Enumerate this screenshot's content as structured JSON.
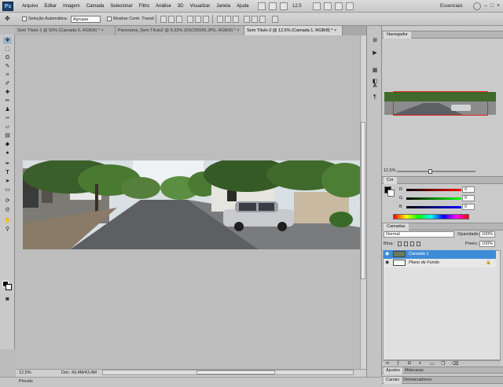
{
  "app": {
    "logo": "Ps"
  },
  "menu": [
    "Arquivo",
    "Editar",
    "Imagem",
    "Camada",
    "Selecionar",
    "Filtro",
    "Análise",
    "3D",
    "Visualizar",
    "Janela",
    "Ajuda"
  ],
  "menubar": {
    "zoom": "12,5",
    "workspace": "Essenciais",
    "minimize": "–",
    "restore": "□",
    "close": "×"
  },
  "options": {
    "auto_select_label": "Seleção Automática:",
    "auto_select_value": "Agrupar",
    "transform_label": "Mostrar Contr. Transf."
  },
  "tabs": [
    {
      "label": "Sem Título-1 @ 50% (Camada 6, RGB/8) *",
      "close": "×"
    },
    {
      "label": "Panorama_Sem Título2 @ 8,33% (DSC05556.JPG, RGB/8) *",
      "close": "×"
    },
    {
      "label": "Sem Título-2 @ 12,5% (Camada 1, RGB/8) *",
      "close": "×"
    }
  ],
  "status": {
    "zoom": "12,5%",
    "doc": "Doc: 43,4M/43,4M"
  },
  "bottom": {
    "label": "Pincéis"
  },
  "panels": {
    "navigator": {
      "title": "Navegador",
      "zoom": "12,5%"
    },
    "color": {
      "title": "Cor",
      "r_label": "R",
      "g_label": "G",
      "b_label": "B",
      "r": "0",
      "g": "0",
      "b": "0"
    },
    "layers": {
      "title": "Camadas",
      "blend": "Normal",
      "opacity_label": "Opacidade:",
      "opacity": "100%",
      "lock_label": "Bloq.:",
      "fill_label": "Preen.:",
      "fill": "100%",
      "items": [
        {
          "name": "Camada 1",
          "selected": true
        },
        {
          "name": "Plano de Fundo",
          "selected": false
        }
      ]
    },
    "bottom_tabs": [
      "Ajustes",
      "Máscaras"
    ],
    "bottom_tabs2": [
      "Canais",
      "Demarcadores"
    ]
  },
  "colors": {
    "accent": "#3f8cd6",
    "nav_rect": "#e02020"
  }
}
